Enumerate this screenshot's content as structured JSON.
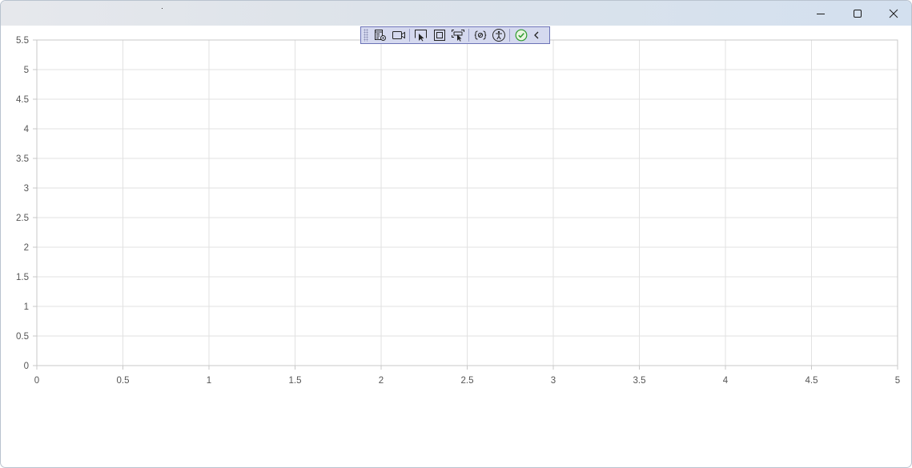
{
  "window": {
    "title": "",
    "controls": [
      "minimize-icon",
      "maximize-icon",
      "close-icon"
    ]
  },
  "debug_toolbar": {
    "icons": [
      "live-visual-tree-icon",
      "record-icon",
      "select-element-icon",
      "display-layout-adorners-icon",
      "track-focused-element-icon",
      "binding-failures-icon",
      "accessibility-checker-icon",
      "no-issues-check-icon",
      "collapse-chevron-icon"
    ]
  },
  "colors": {
    "titlebar_start": "#e6e8ec",
    "titlebar_end": "#d3e0ef",
    "grid": "#e2e2e2",
    "axis": "#c8c8c8",
    "toolbar_bg": "#d5d9ef",
    "toolbar_border": "#6b73b7",
    "check_green": "#2e9b2e"
  },
  "chart_data": {
    "type": "line",
    "series": [],
    "xlim": [
      0,
      5
    ],
    "ylim": [
      0,
      5.5
    ],
    "x_ticks": [
      "0",
      "0.5",
      "1",
      "1.5",
      "2",
      "2.5",
      "3",
      "3.5",
      "4",
      "4.5",
      "5"
    ],
    "y_ticks": [
      "0",
      "0.5",
      "1",
      "1.5",
      "2",
      "2.5",
      "3",
      "3.5",
      "4",
      "4.5",
      "5",
      "5.5"
    ],
    "grid": true,
    "title": "",
    "xlabel": "",
    "ylabel": ""
  }
}
